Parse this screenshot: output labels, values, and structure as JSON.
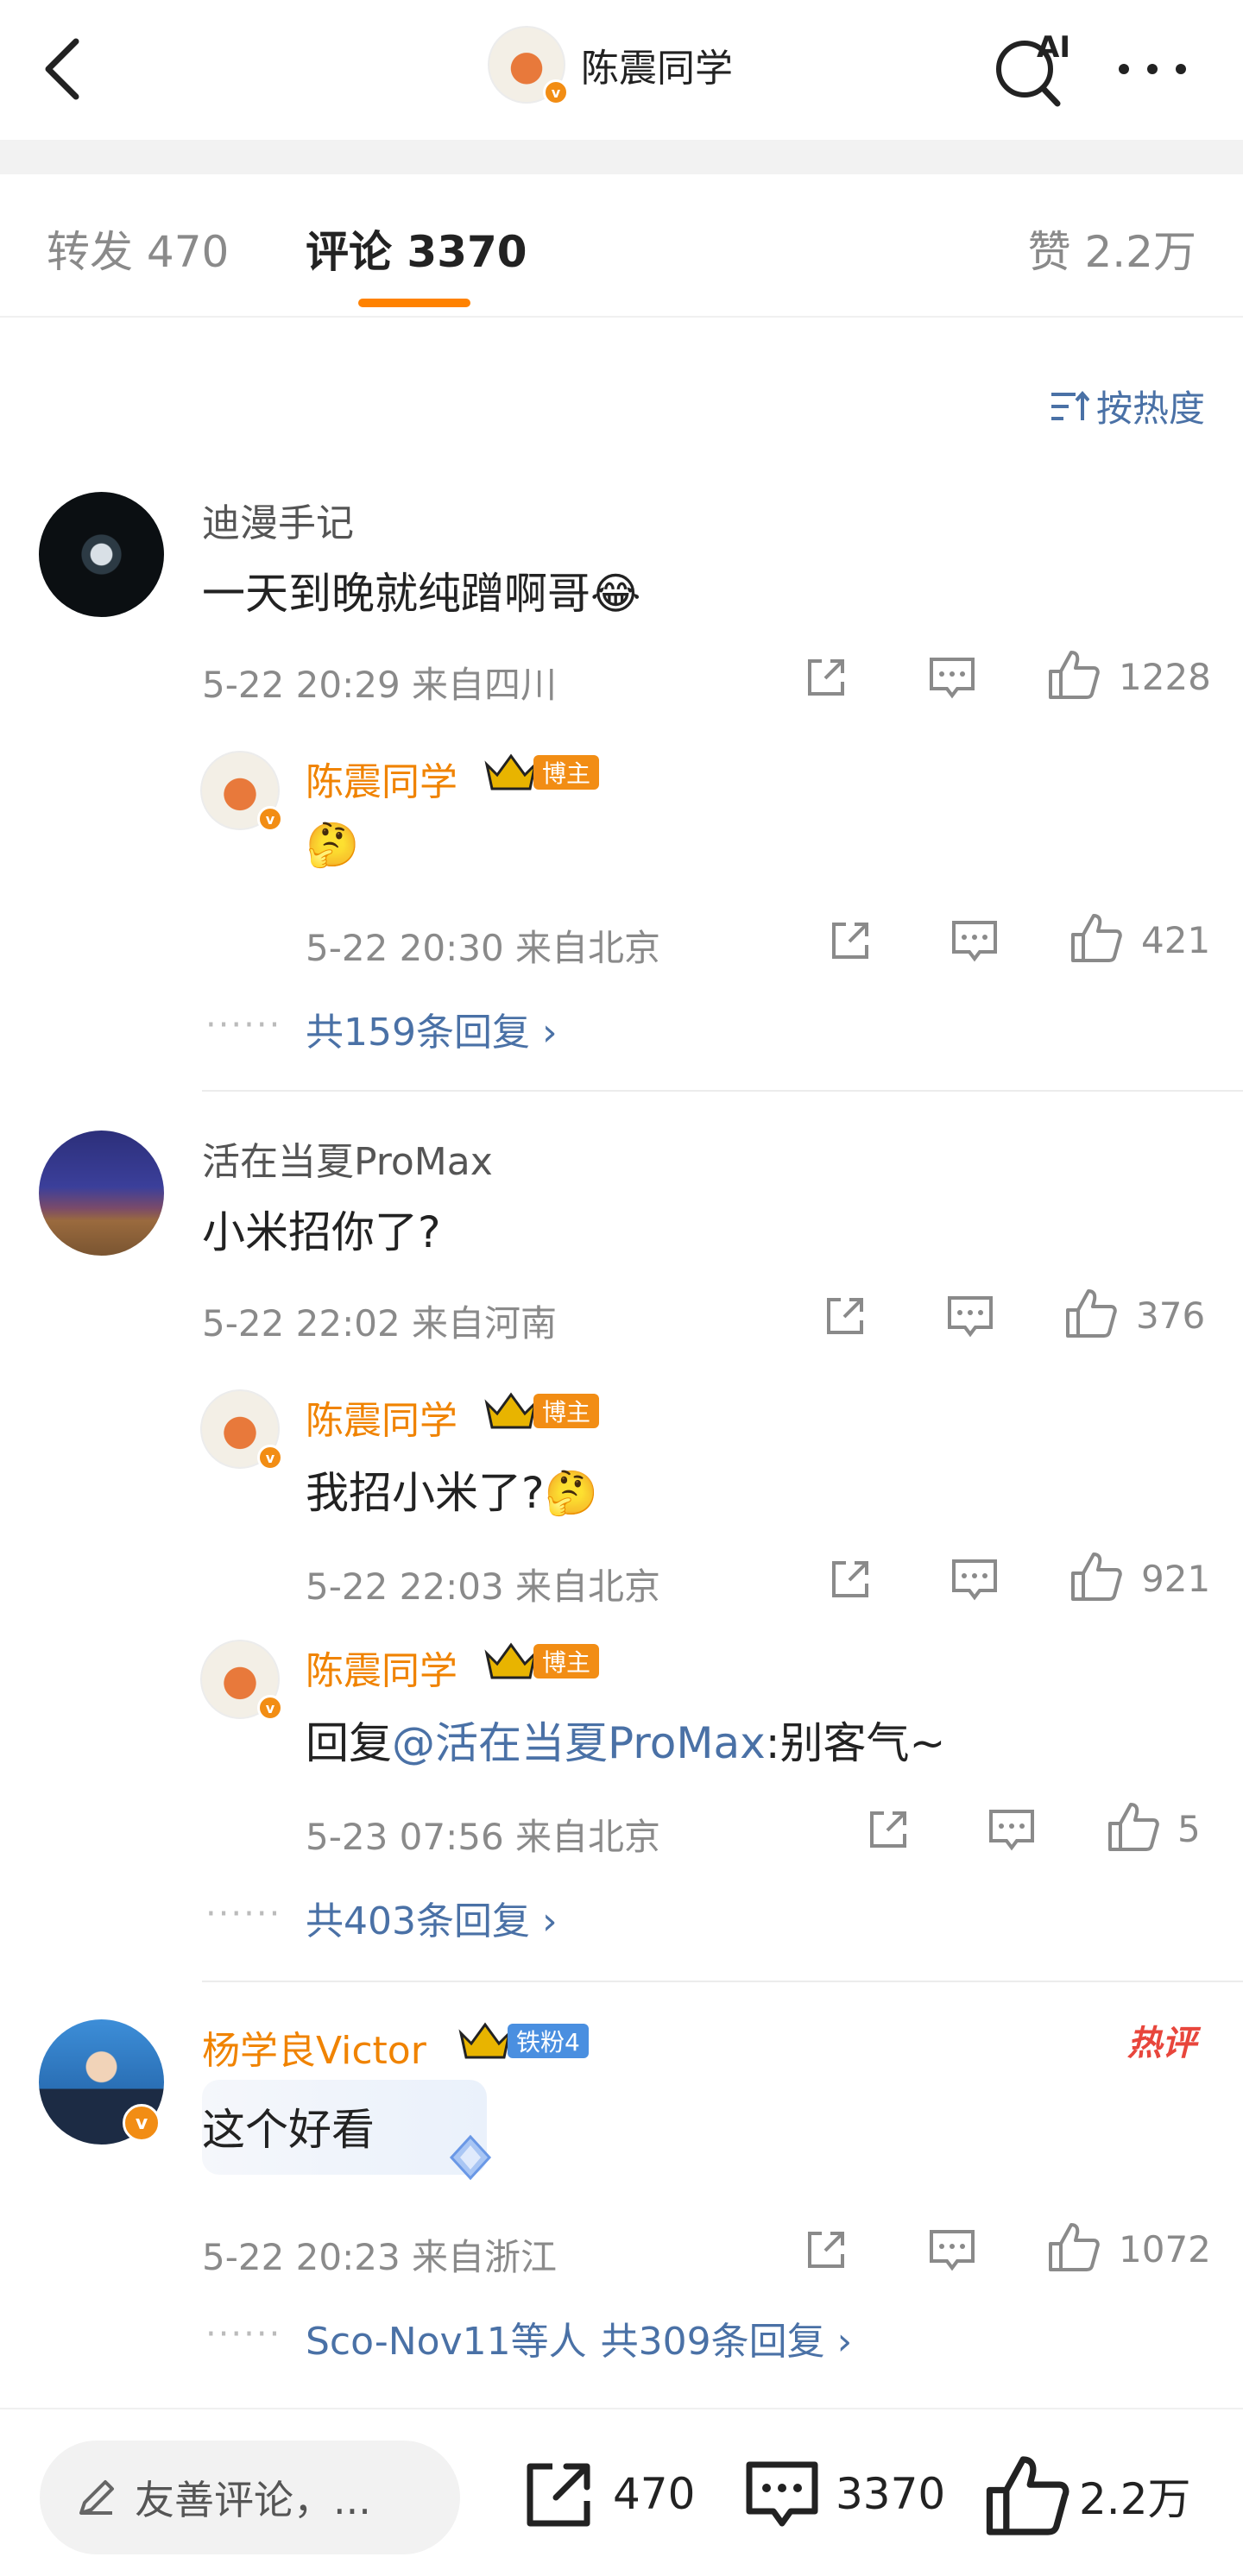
{
  "header": {
    "title": "陈震同学",
    "ai_label": "AI"
  },
  "tabs": {
    "repost": "转发 470",
    "comments": "评论 3370",
    "likes": "赞 2.2万"
  },
  "sort": {
    "label": "按热度"
  },
  "comments": [
    {
      "user": "迪漫手记",
      "text": "一天到晚就纯蹭啊哥",
      "emoji": "😂",
      "time": "5-22 20:29 来自四川",
      "likes": "1228",
      "replies": [
        {
          "user": "陈震同学",
          "badge": "博主",
          "text": "",
          "emoji": "🤔",
          "time": "5-22 20:30 来自北京",
          "likes": "421"
        }
      ],
      "more": "共159条回复 ›"
    },
    {
      "user": "活在当夏ProMax",
      "text": "小米招你了?",
      "time": "5-22 22:02 来自河南",
      "likes": "376",
      "replies": [
        {
          "user": "陈震同学",
          "badge": "博主",
          "text": "我招小米了?",
          "emoji": "🤔",
          "time": "5-22 22:03 来自北京",
          "likes": "921"
        },
        {
          "user": "陈震同学",
          "badge": "博主",
          "prefix": "回复",
          "mention": "@活在当夏ProMax",
          "text": ":别客气~",
          "time": "5-23 07:56 来自北京",
          "likes": "5"
        }
      ],
      "more": "共403条回复 ›"
    },
    {
      "user": "杨学良Victor",
      "badge": "铁粉4",
      "hot": "热评",
      "text": "这个好看",
      "time": "5-22 20:23 来自浙江",
      "likes": "1072",
      "more_users": "Sco-Nov11等人",
      "more": "共309条回复 ›"
    }
  ],
  "bottom_bar": {
    "input_placeholder": "友善评论，...",
    "reposts": "470",
    "comments": "3370",
    "likes": "2.2万"
  },
  "colors": {
    "accent": "#ff8200",
    "link": "#4a71a6",
    "blogger_name": "#f08300",
    "hot": "#e8463c"
  }
}
